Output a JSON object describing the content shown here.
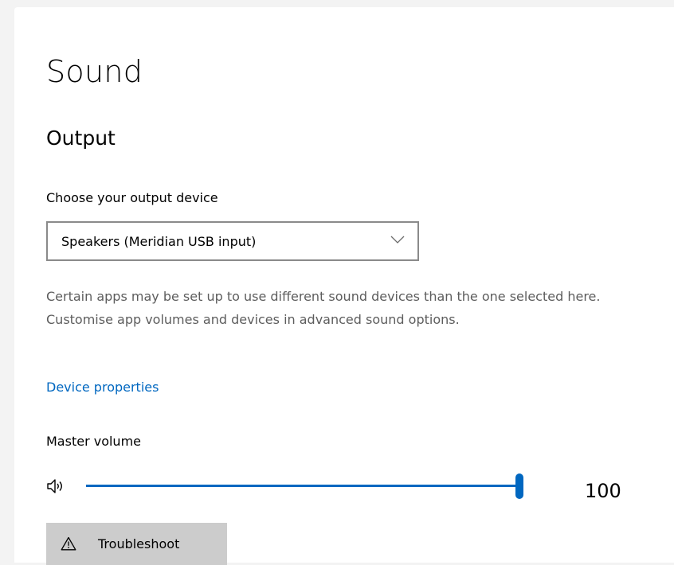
{
  "page": {
    "title": "Sound"
  },
  "output": {
    "section_title": "Output",
    "device_label": "Choose your output device",
    "device_selected": "Speakers (Meridian USB input)",
    "description": "Certain apps may be set up to use different sound devices than the one selected here. Customise app volumes and devices in advanced sound options.",
    "device_properties_link": "Device properties",
    "volume_label": "Master volume",
    "volume_value": "100",
    "volume_level": 100,
    "volume_max": 100,
    "speaker_icon": "speaker-icon",
    "troubleshoot_label": "Troubleshoot",
    "troubleshoot_icon": "warning-icon"
  },
  "colors": {
    "accent": "#0067c0",
    "secondary_text": "#5d5d5d",
    "button_bg": "#cccccc"
  }
}
